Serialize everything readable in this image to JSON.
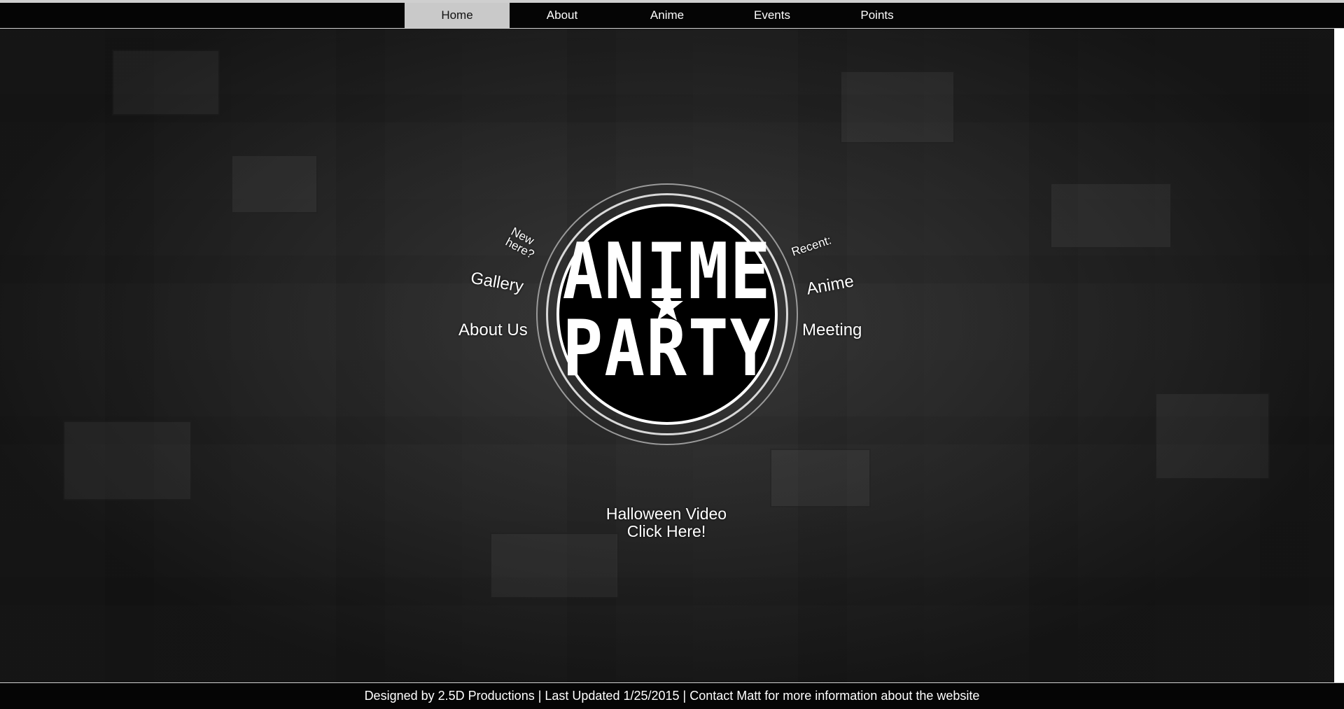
{
  "nav": {
    "items": [
      {
        "label": "Home",
        "active": true
      },
      {
        "label": "About",
        "active": false
      },
      {
        "label": "Anime",
        "active": false
      },
      {
        "label": "Events",
        "active": false
      },
      {
        "label": "Points",
        "active": false
      }
    ]
  },
  "logo": {
    "line1": "ANIME",
    "line2": "PARTY",
    "star_icon": "star-icon"
  },
  "left_links": {
    "new_here": "New here?",
    "gallery": "Gallery",
    "about_us": "About Us"
  },
  "right_links": {
    "recent": "Recent:",
    "anime": "Anime",
    "meeting": "Meeting"
  },
  "video": {
    "line1": "Halloween Video",
    "line2": "Click Here!"
  },
  "footer": {
    "text": "Designed by 2.5D Productions | Last Updated 1/25/2015 | Contact Matt for more information about the website"
  },
  "colors": {
    "nav_bg": "#050505",
    "nav_active_bg": "#c9c9c9",
    "text": "#ffffff"
  }
}
